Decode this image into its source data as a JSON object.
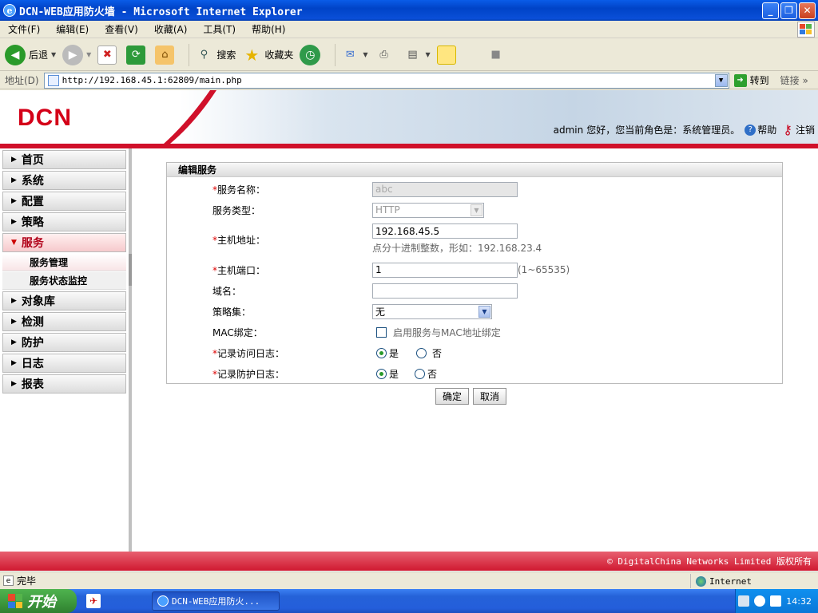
{
  "window": {
    "title": "DCN-WEB应用防火墙 - Microsoft Internet Explorer"
  },
  "menu": [
    "文件(F)",
    "编辑(E)",
    "查看(V)",
    "收藏(A)",
    "工具(T)",
    "帮助(H)"
  ],
  "toolbar": {
    "back": "后退",
    "search": "搜索",
    "favorites": "收藏夹"
  },
  "address": {
    "label": "地址(D)",
    "url": "http://192.168.45.1:62809/main.php",
    "go": "转到",
    "links": "链接"
  },
  "header": {
    "logo": "DCN",
    "user": "admin",
    "greeting": "您好，您当前角色是：系统管理员。",
    "help": "帮助",
    "logout": "注销"
  },
  "sidebar": {
    "items": [
      "首页",
      "系统",
      "配置",
      "策略",
      "服务"
    ],
    "subitems": [
      "服务管理",
      "服务状态监控"
    ],
    "items2": [
      "对象库",
      "检测",
      "防护",
      "日志",
      "报表"
    ]
  },
  "form": {
    "title": "编辑服务",
    "required_mark": "*",
    "service_name": {
      "label": "服务名称：",
      "value": "abc"
    },
    "service_type": {
      "label": "服务类型：",
      "value": "HTTP"
    },
    "host_addr": {
      "label": "主机地址：",
      "value": "192.168.45.5",
      "hint": "点分十进制整数，形如：192.168.23.4"
    },
    "host_port": {
      "label": "主机端口：",
      "value": "1",
      "range": "(1~65535)"
    },
    "domain": {
      "label": "域名：",
      "value": ""
    },
    "policy_set": {
      "label": "策略集：",
      "value": "无"
    },
    "mac_bind": {
      "label": "MAC绑定：",
      "checkbox_label": "启用服务与MAC地址绑定"
    },
    "access_log": {
      "label": "记录访问日志：",
      "yes": "是",
      "no": "否",
      "selected": "yes"
    },
    "protect_log": {
      "label": "记录防护日志：",
      "yes": "是",
      "no": "否",
      "selected": "yes"
    },
    "ok": "确定",
    "cancel": "取消"
  },
  "footer": {
    "copyright": "© DigitalChina Networks Limited 版权所有"
  },
  "statusbar": {
    "status": "完毕",
    "zone": "Internet"
  },
  "taskbar": {
    "start": "开始",
    "task": "DCN-WEB应用防火...",
    "clock": "14:32"
  }
}
